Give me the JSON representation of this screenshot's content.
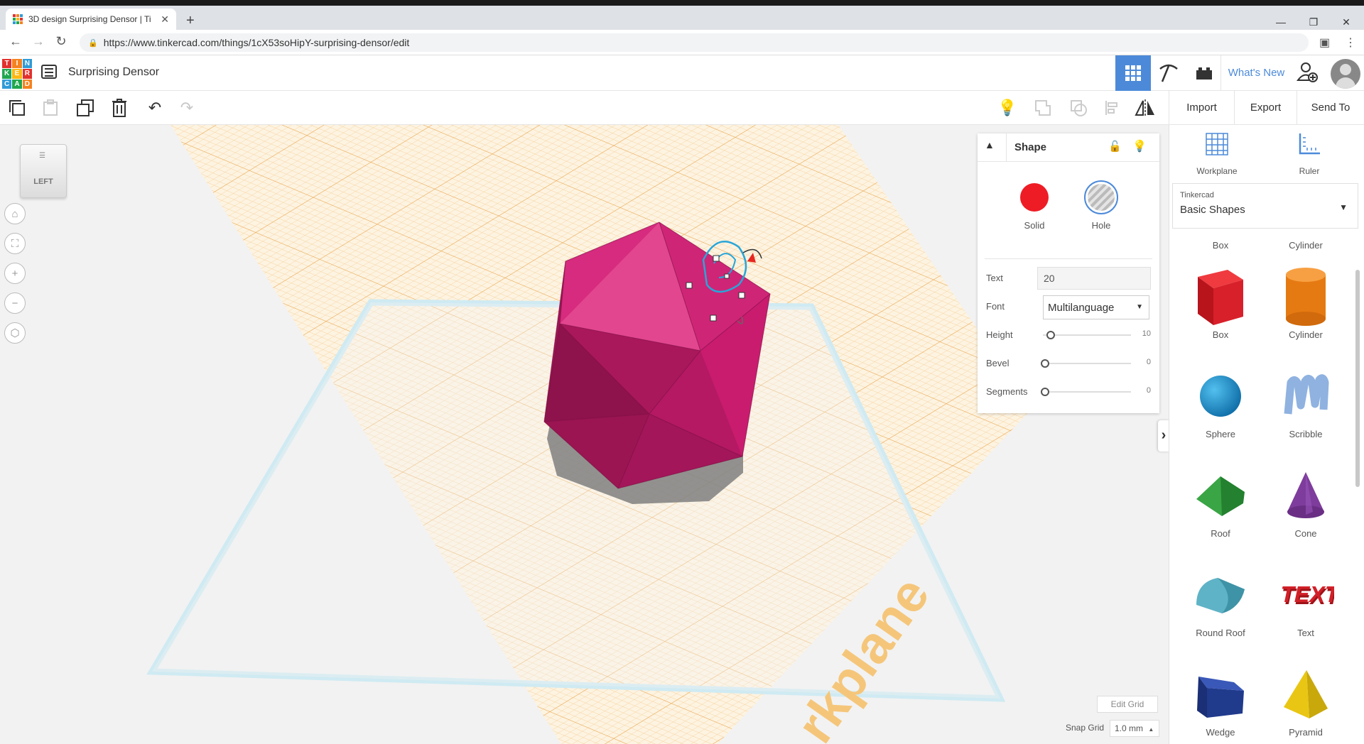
{
  "browser": {
    "tab_title": "3D design Surprising Densor | Ti",
    "new_tab": "+",
    "url": "https://www.tinkercad.com/things/1cX53soHipY-surprising-densor/edit",
    "window_controls": [
      "—",
      "❐",
      "✕"
    ]
  },
  "app": {
    "logo_letters": [
      "T",
      "I",
      "N",
      "K",
      "E",
      "R",
      "C",
      "A",
      "D"
    ],
    "design_name": "Surprising Densor",
    "whats_new": "What's New"
  },
  "toolbar": {
    "import": "Import",
    "export": "Export",
    "send_to": "Send To"
  },
  "viewcube": {
    "face": "LEFT"
  },
  "inspector": {
    "title": "Shape",
    "solid_label": "Solid",
    "hole_label": "Hole",
    "text_label": "Text",
    "text_value": "20",
    "font_label": "Font",
    "font_value": "Multilanguage",
    "height_label": "Height",
    "height_value": "10",
    "bevel_label": "Bevel",
    "bevel_value": "0",
    "segments_label": "Segments",
    "segments_value": "0"
  },
  "workspace": {
    "edit_grid": "Edit Grid",
    "snap_grid_label": "Snap Grid",
    "snap_grid_value": "1.0 mm",
    "workplane_watermark": "rkplane"
  },
  "shapes_panel": {
    "workplane": "Workplane",
    "ruler": "Ruler",
    "library_provider": "Tinkercad",
    "library_name": "Basic Shapes",
    "cut_labels": [
      "Box",
      "Cylinder"
    ],
    "shapes": [
      {
        "label": "Box",
        "color": "#d8202a"
      },
      {
        "label": "Cylinder",
        "color": "#e67a12"
      },
      {
        "label": "Sphere",
        "color": "#1a8fd0"
      },
      {
        "label": "Scribble",
        "color": "#8fb2e0"
      },
      {
        "label": "Roof",
        "color": "#3aa545"
      },
      {
        "label": "Cone",
        "color": "#7e3c9c"
      },
      {
        "label": "Round Roof",
        "color": "#5fb3c6"
      },
      {
        "label": "Text",
        "color": "#d22028"
      },
      {
        "label": "Wedge",
        "color": "#203a8c"
      },
      {
        "label": "Pyramid",
        "color": "#e9c613"
      }
    ]
  },
  "colors": {
    "accent": "#4c8ad9",
    "solid": "#ee1c25",
    "shape_magenta": "#c8186a",
    "grid_orange": "#f0a830",
    "workplane_outline": "#bde4f0"
  }
}
